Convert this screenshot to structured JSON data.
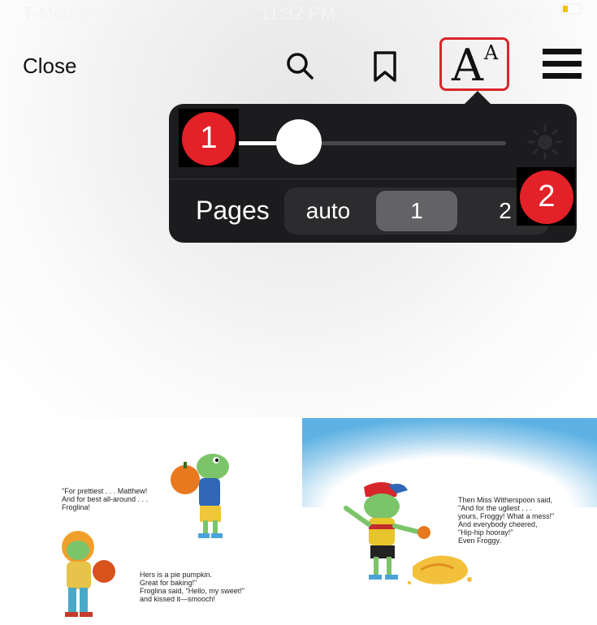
{
  "status_bar": {
    "carrier": "T-Mobile",
    "time": "11:32 PM",
    "battery": "17%",
    "wifi_icon": "wifi-icon"
  },
  "toolbar": {
    "close_label": "Close",
    "search_icon": "search-icon",
    "bookmark_icon": "bookmark-icon",
    "font_icon": "text-size-icon",
    "font_big": "A",
    "font_small": "A",
    "menu_icon": "menu-icon",
    "highlight_color": "#d9262b"
  },
  "popover": {
    "brightness": 0.24,
    "sun_icon": "sun-icon",
    "pages_label": "Pages",
    "page_options": [
      "auto",
      "1",
      "2"
    ],
    "selected_page_option": "1"
  },
  "callouts": {
    "one": "1",
    "two": "2",
    "color": "#e32128"
  },
  "book": {
    "left_text_1": "\"For prettiest . . . Matthew!\nAnd for best all-around . . .\nFroglina!",
    "left_text_2": "Hers is a pie pumpkin.\nGreat for baking!\"\nFroglina said, \"Hello, my sweet!\"\nand kissed it—smooch!",
    "right_text_1": "Then Miss Witherspoon said,\n\"And for the ugliest . . .\nyours, Froggy! What a mess!\"\nAnd everybody cheered,\n\"Hip-hip hooray!\"\nEven Froggy."
  }
}
